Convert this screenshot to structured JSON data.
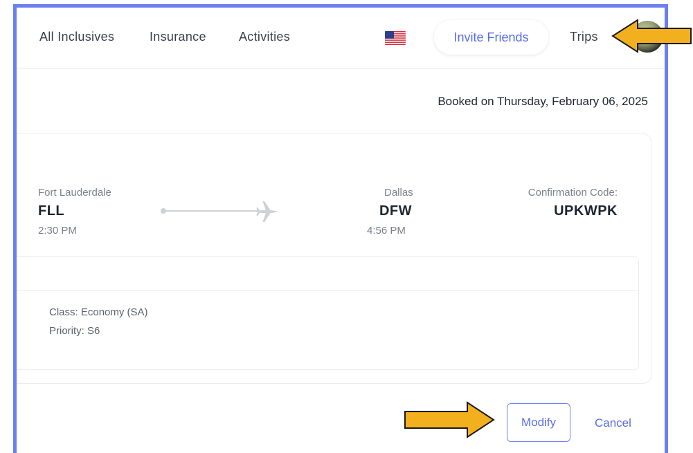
{
  "nav": {
    "links": [
      "All Inclusives",
      "Insurance",
      "Activities"
    ],
    "flag_icon": "us-flag-icon",
    "invite_label": "Invite Friends",
    "trips_label": "Trips"
  },
  "booking": {
    "booked_on": "Booked on Thursday, February 06, 2025",
    "origin": {
      "city": "Fort Lauderdale",
      "code": "FLL",
      "time": "2:30 PM"
    },
    "destination": {
      "city": "Dallas",
      "code": "DFW",
      "time": "4:56 PM"
    },
    "confirmation_label": "Confirmation Code:",
    "confirmation_code": "UPKWPK",
    "class_text": "Class: Economy (SA)",
    "priority_text": "Priority: S6"
  },
  "actions": {
    "modify_label": "Modify",
    "cancel_label": "Cancel"
  },
  "colors": {
    "accent": "#5a6cea",
    "frame_border": "#6a7ff0",
    "annotation_arrow": "#f2b01e"
  }
}
